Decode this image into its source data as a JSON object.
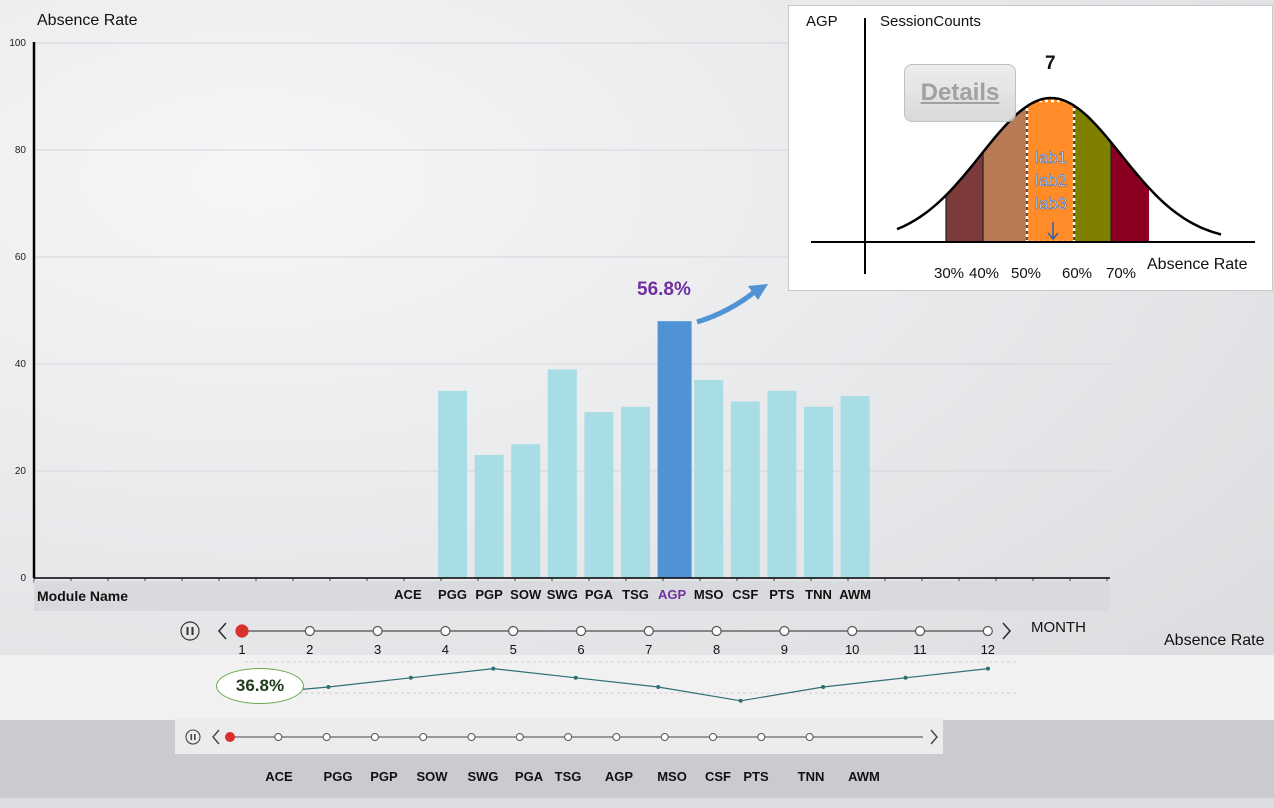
{
  "chart_data": [
    {
      "type": "bar",
      "ylabel": "Absence Rate",
      "xlabel": "Module Name",
      "ylim": [
        0,
        100
      ],
      "y_ticks": [
        "0",
        "20",
        "40",
        "60",
        "80",
        "100"
      ],
      "categories": [
        "ACE",
        "PGG",
        "PGP",
        "SOW",
        "SWG",
        "PGA",
        "TSG",
        "AGP",
        "MSO",
        "CSF",
        "PTS",
        "TNN",
        "AWM"
      ],
      "values": [
        0,
        35,
        23,
        25,
        39,
        31,
        32,
        48,
        37,
        33,
        35,
        32,
        34
      ],
      "highlighted": "AGP",
      "highlight_label": "56.8%",
      "colors": {
        "bar": "#a8dde6",
        "highlight": "#4f93d4",
        "highlight_label": "#7030a0"
      }
    },
    {
      "type": "area",
      "title": "AGP",
      "ylabel": "SessionCounts",
      "xlabel": "Absence Rate",
      "x_ticks": [
        "30%",
        "40%",
        "50%",
        "60%",
        "70%"
      ],
      "peak_value": "7",
      "highlight_bin": "50%-60%",
      "bin_labels": [
        "lab1",
        "lab2",
        "lab3"
      ],
      "bin_colors": [
        "#7c3a3a",
        "#b87a55",
        "#ff8c29",
        "#7f7f00",
        "#8b0020"
      ],
      "details_label": "Details"
    },
    {
      "type": "line",
      "ylabel": "Absence Rate",
      "point_label": "36.8%",
      "values": [
        36.8,
        40,
        44,
        48,
        44,
        40,
        34,
        40,
        44,
        48
      ]
    }
  ],
  "timeline_month": {
    "label": "MONTH",
    "months": [
      "1",
      "2",
      "3",
      "4",
      "5",
      "6",
      "7",
      "8",
      "9",
      "10",
      "11",
      "12"
    ],
    "selected_index": 0
  },
  "timeline_module": {
    "modules": [
      "ACE",
      "PGG",
      "PGP",
      "SOW",
      "SWG",
      "PGA",
      "TSG",
      "AGP",
      "MSO",
      "CSF",
      "PTS",
      "TNN",
      "AWM"
    ],
    "selected_index": 0
  },
  "icons": {
    "pause": "pause-icon",
    "prev": "chevron-left-icon",
    "next": "chevron-right-icon"
  }
}
